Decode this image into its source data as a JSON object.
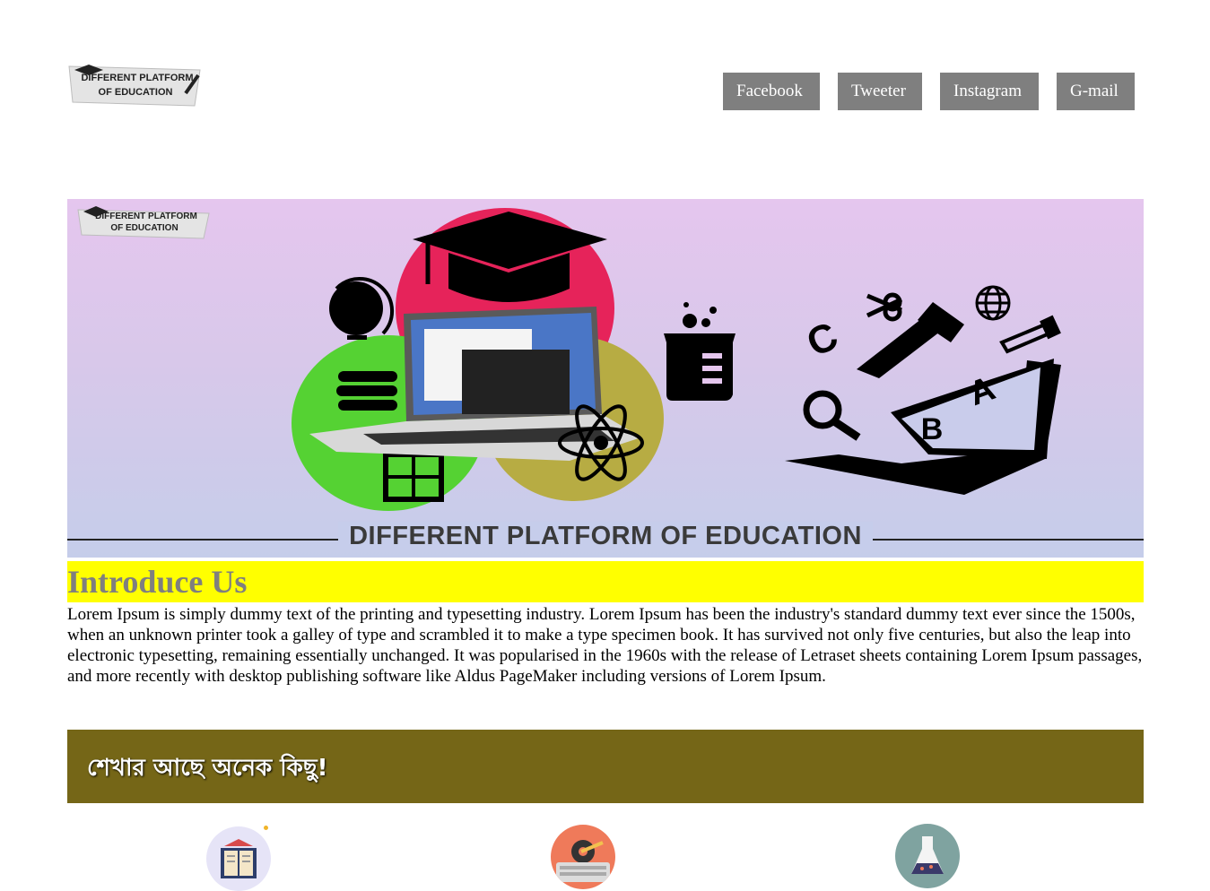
{
  "header": {
    "logo_text_line1": "DIFFERENT PLATFORM",
    "logo_text_line2": "OF EDUCATION",
    "social_links": [
      {
        "label": "Facebook"
      },
      {
        "label": "Tweeter"
      },
      {
        "label": "Instagram"
      },
      {
        "label": "G-mail"
      }
    ]
  },
  "banner": {
    "logo_text_line1": "DIFFERENT PLATFORM",
    "logo_text_line2": "OF EDUCATION",
    "title": "DIFFERENT PLATFORM OF EDUCATION",
    "letters": [
      "A",
      "B",
      "C"
    ]
  },
  "intro": {
    "title": "Introduce Us",
    "body": "Lorem Ipsum is simply dummy text of the printing and typesetting industry. Lorem Ipsum has been the industry's standard dummy text ever since the 1500s, when an unknown printer took a galley of type and scrambled it to make a type specimen book. It has survived not only five centuries, but also the leap into electronic typesetting, remaining essentially unchanged. It was popularised in the 1960s with the release of Letraset sheets containing Lorem Ipsum passages, and more recently with desktop publishing software like Aldus PageMaker including versions of Lorem Ipsum."
  },
  "learn": {
    "heading": "শেখার আছে অনেক কিছু!"
  },
  "features": [
    {
      "icon": "book-icon",
      "color": "#e6e4f7"
    },
    {
      "icon": "keyboard-gear-icon",
      "color": "#ef7a5a"
    },
    {
      "icon": "flask-icon",
      "color": "#7fa3a0"
    }
  ],
  "colors": {
    "social_button_bg": "#7f7f7f",
    "intro_highlight": "#ffff00",
    "learn_band": "#756617"
  }
}
